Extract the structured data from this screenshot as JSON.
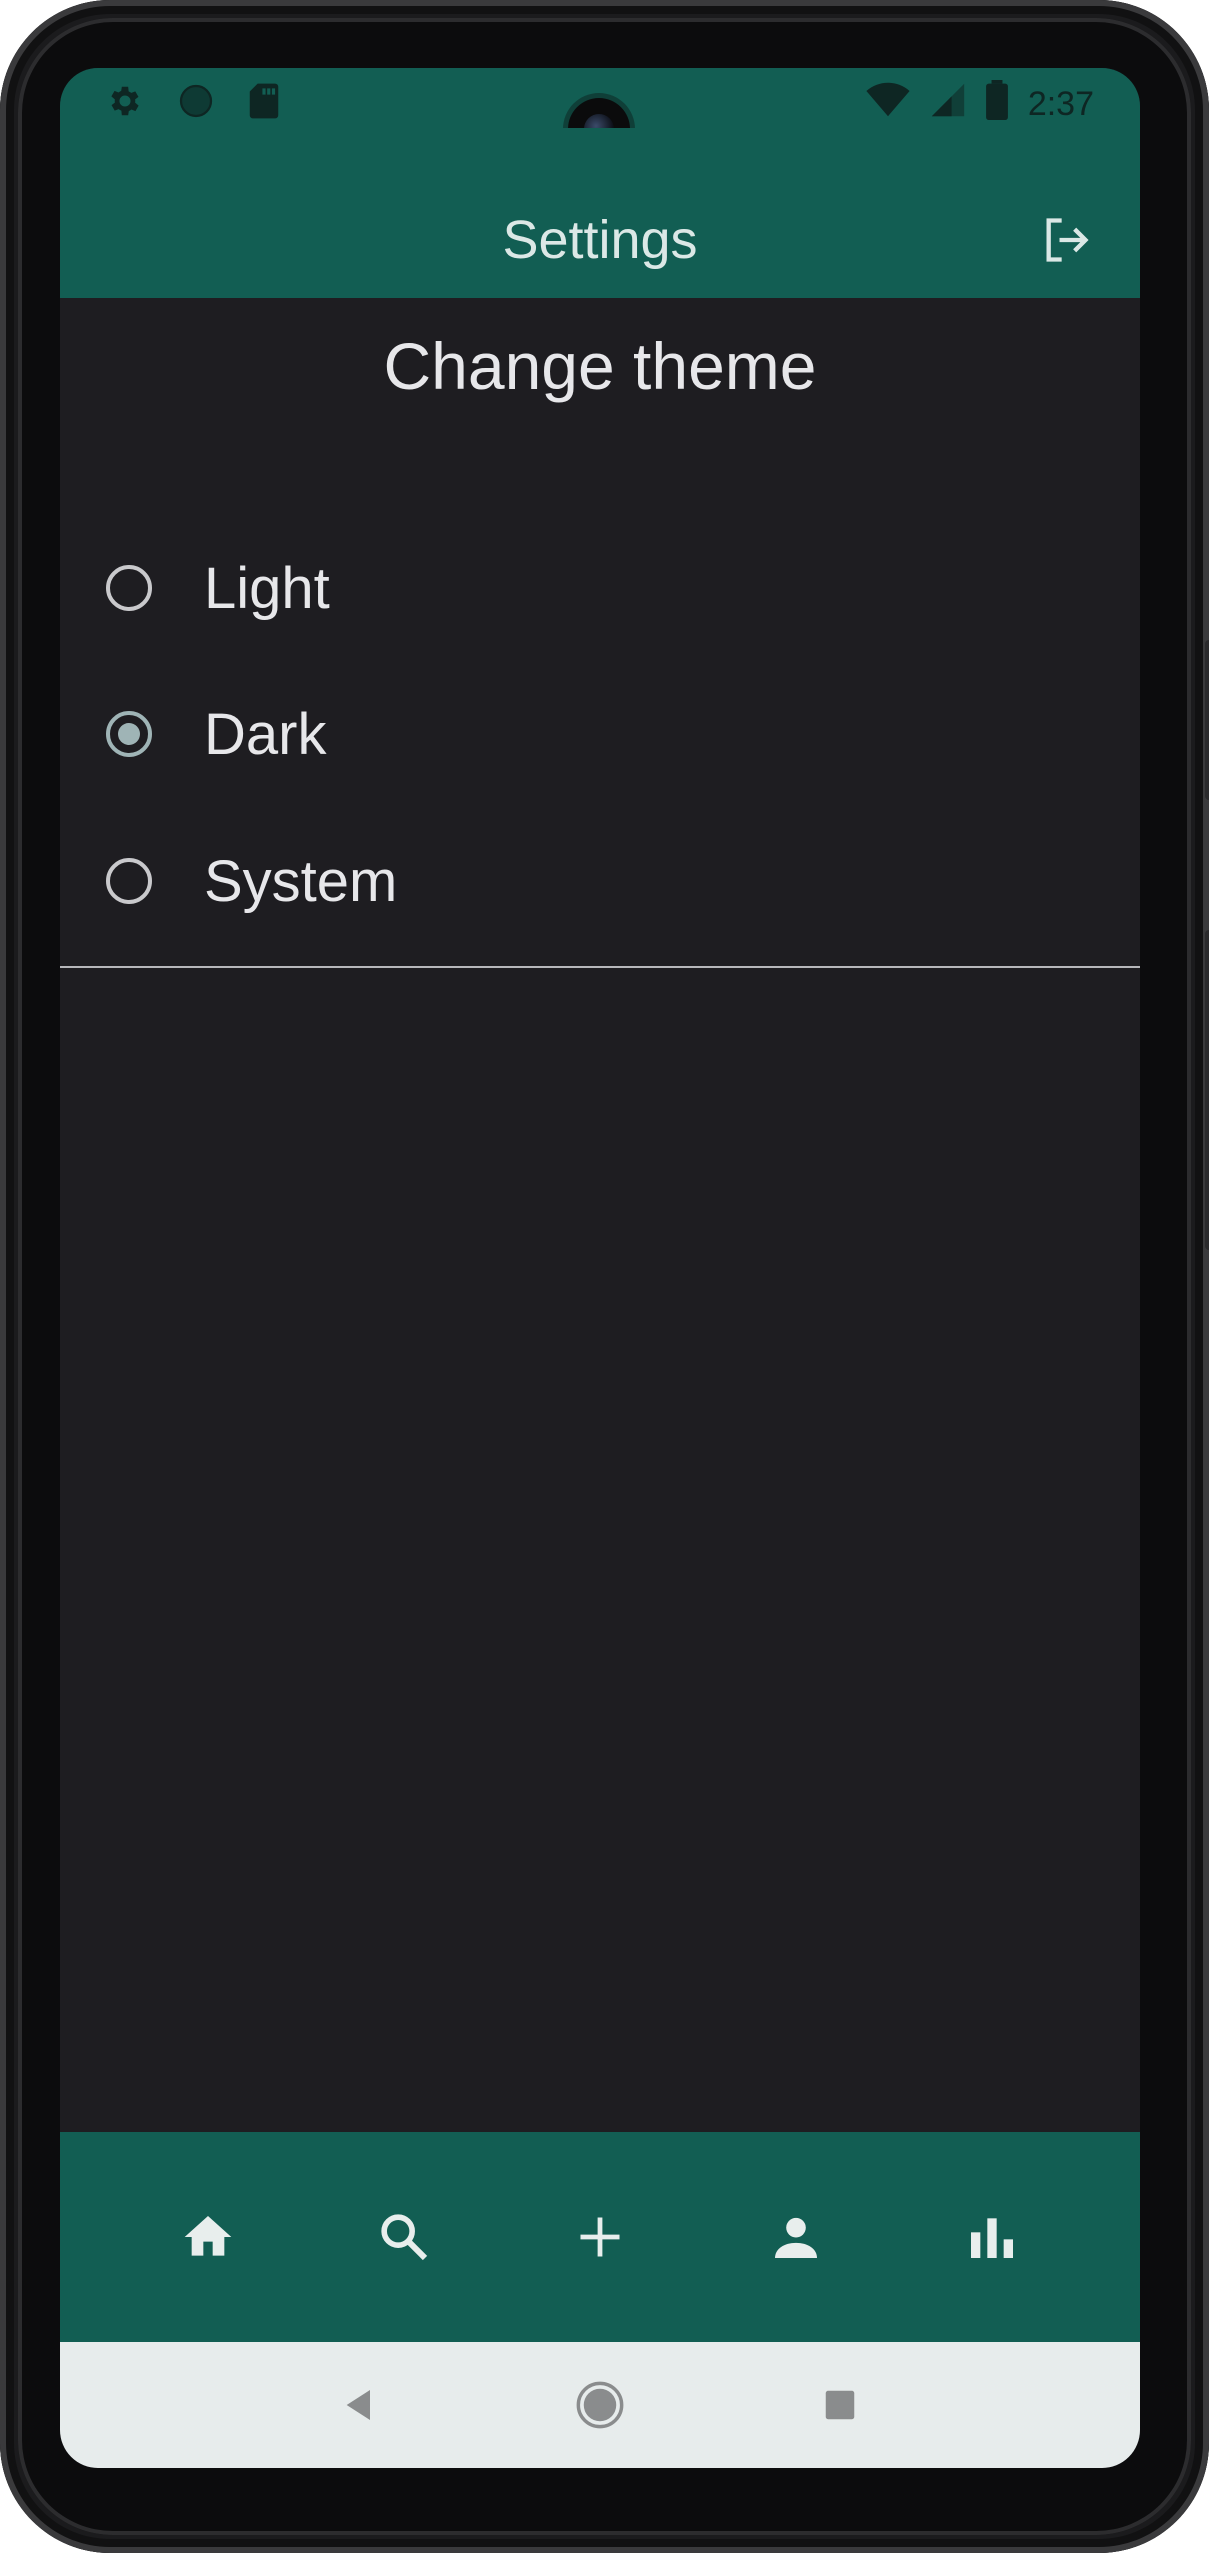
{
  "status_bar": {
    "time": "2:37",
    "left_icons": [
      "gear-icon",
      "circle-icon",
      "sd-card-icon"
    ],
    "right_icons": [
      "wifi-icon",
      "signal-icon",
      "battery-icon"
    ]
  },
  "app_bar": {
    "title": "Settings",
    "action_icon": "logout-icon"
  },
  "theme_section": {
    "title": "Change theme",
    "options": [
      {
        "label": "Light",
        "selected": false
      },
      {
        "label": "Dark",
        "selected": true
      },
      {
        "label": "System",
        "selected": false
      }
    ]
  },
  "bottom_nav": {
    "items": [
      "home-icon",
      "search-icon",
      "add-icon",
      "person-icon",
      "bar-chart-icon"
    ]
  },
  "system_nav": {
    "buttons": [
      "back-icon",
      "home-circle-icon",
      "recents-icon"
    ]
  },
  "colors": {
    "primary": "#125e53",
    "background": "#1e1d21",
    "on_primary": "#dbe8e6",
    "text": "#e7e7ea",
    "radio_selected": "#9fb4b6",
    "system_bar": "#e7ecec"
  }
}
